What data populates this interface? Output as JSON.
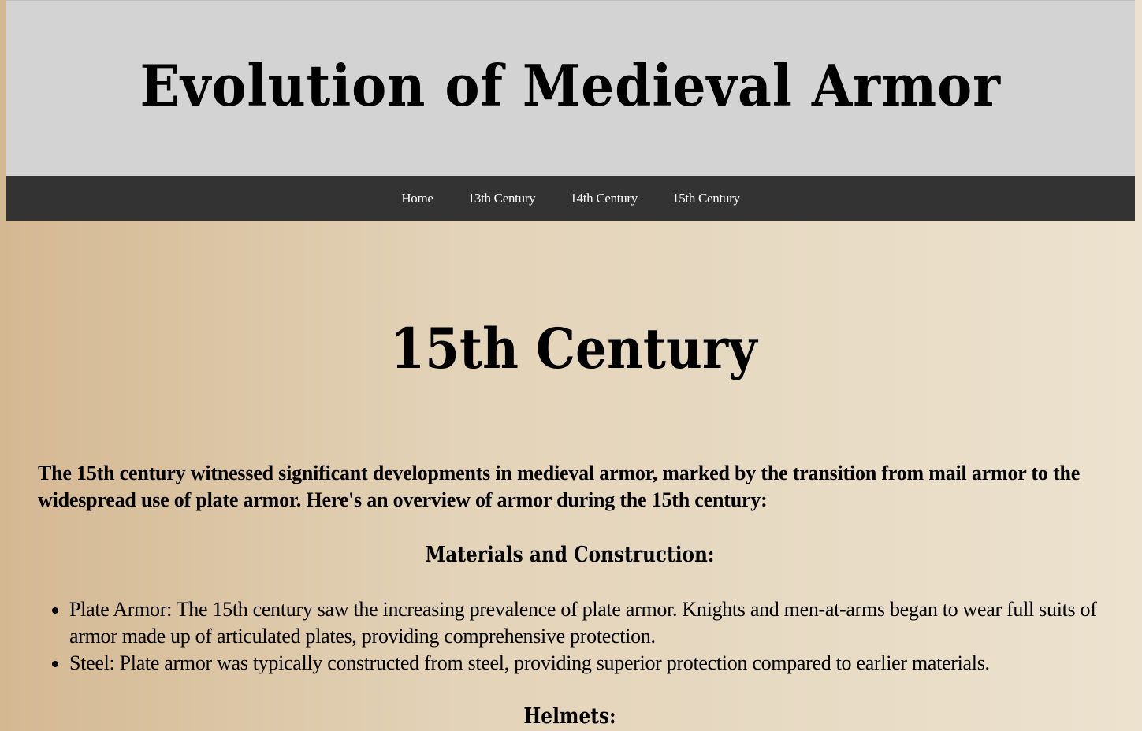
{
  "header": {
    "title": "Evolution of Medieval Armor"
  },
  "nav": {
    "items": [
      {
        "label": "Home"
      },
      {
        "label": "13th Century"
      },
      {
        "label": "14th Century"
      },
      {
        "label": "15th Century"
      }
    ]
  },
  "main": {
    "heading": "15th Century",
    "intro": "The 15th century witnessed significant developments in medieval armor, marked by the transition from mail armor to the widespread use of plate armor. Here's an overview of armor during the 15th century:",
    "sections": [
      {
        "heading": "Materials and Construction:",
        "items": [
          "Plate Armor: The 15th century saw the increasing prevalence of plate armor. Knights and men-at-arms began to wear full suits of armor made up of articulated plates, providing comprehensive protection.",
          "Steel: Plate armor was typically constructed from steel, providing superior protection compared to earlier materials."
        ]
      },
      {
        "heading": "Helmets:"
      }
    ]
  },
  "colors": {
    "header_bg": "#d3d3d3",
    "nav_bg": "#333333",
    "nav_text": "#ffffff",
    "page_bg_left": "#d4b892",
    "page_bg_right": "#ece2cf"
  }
}
